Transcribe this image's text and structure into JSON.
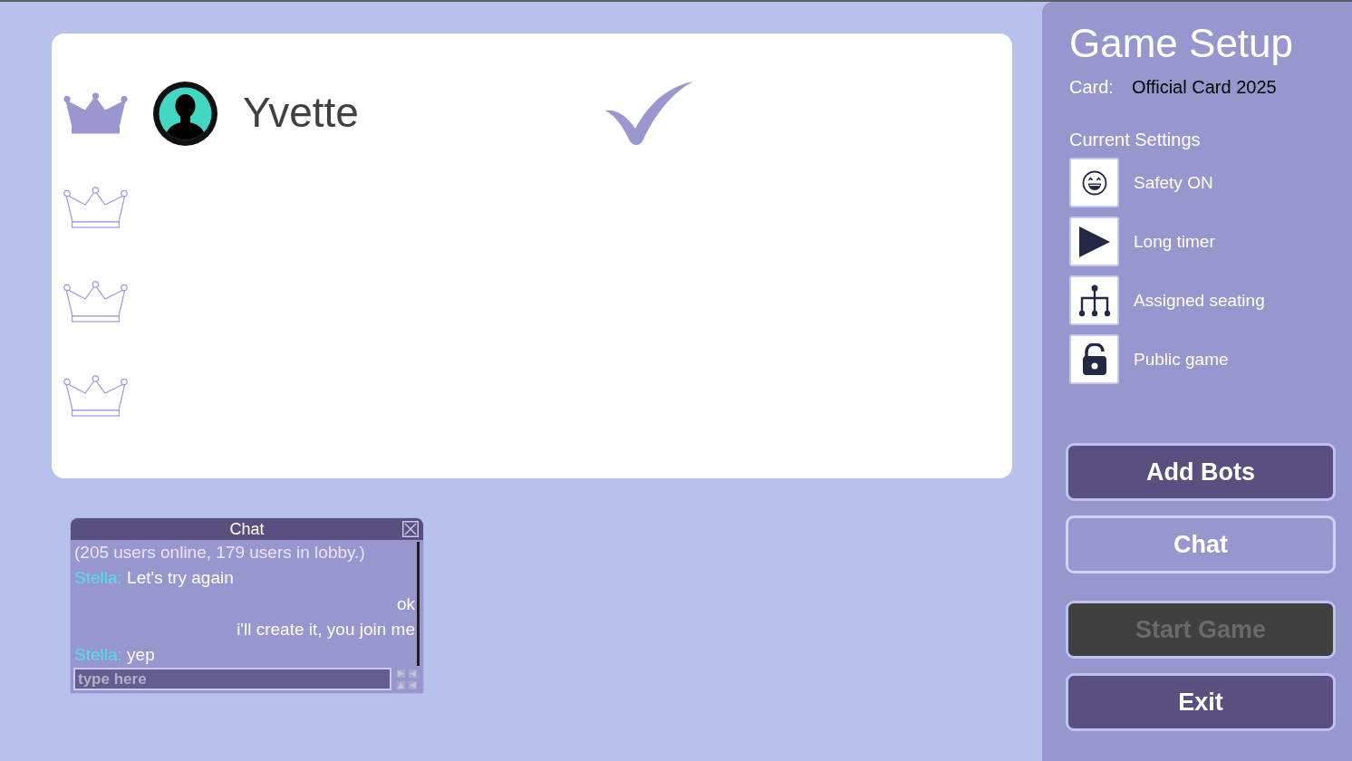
{
  "seats": [
    {
      "kind": "player",
      "host": true,
      "name": "Yvette",
      "ready": true
    },
    {
      "kind": "empty",
      "host": false,
      "ready": false
    },
    {
      "kind": "empty",
      "host": false,
      "ready": false
    },
    {
      "kind": "empty",
      "host": false,
      "ready": false
    }
  ],
  "chat": {
    "title": "Chat",
    "messages": [
      {
        "kind": "system",
        "text": "(205 users online, 179 users in lobby.)"
      },
      {
        "kind": "incoming",
        "sender": "Stella:",
        "text": "Let's try again"
      },
      {
        "kind": "outgoing",
        "text": "ok"
      },
      {
        "kind": "outgoing",
        "text": "i'll create it, you join me"
      },
      {
        "kind": "incoming",
        "sender": "Stella:",
        "text": "yep"
      }
    ],
    "input": {
      "placeholder": "type here"
    }
  },
  "setup": {
    "title": "Game Setup",
    "card": {
      "label": "Card:",
      "value": "Official Card 2025"
    },
    "settings_heading": "Current Settings",
    "settings": [
      {
        "kind": "safety",
        "label": "Safety ON"
      },
      {
        "kind": "timer",
        "label": "Long timer"
      },
      {
        "kind": "seating",
        "label": "Assigned seating"
      },
      {
        "kind": "visibility",
        "label": "Public game"
      }
    ]
  },
  "button_groups": [
    [
      {
        "label": "Add Bots",
        "kind": "filled",
        "disabled": false
      },
      {
        "label": "Chat",
        "kind": "outline",
        "disabled": false
      }
    ],
    [
      {
        "label": "Start Game",
        "kind": "filled",
        "disabled": true
      },
      {
        "label": "Exit",
        "kind": "filled",
        "disabled": false
      }
    ]
  ]
}
